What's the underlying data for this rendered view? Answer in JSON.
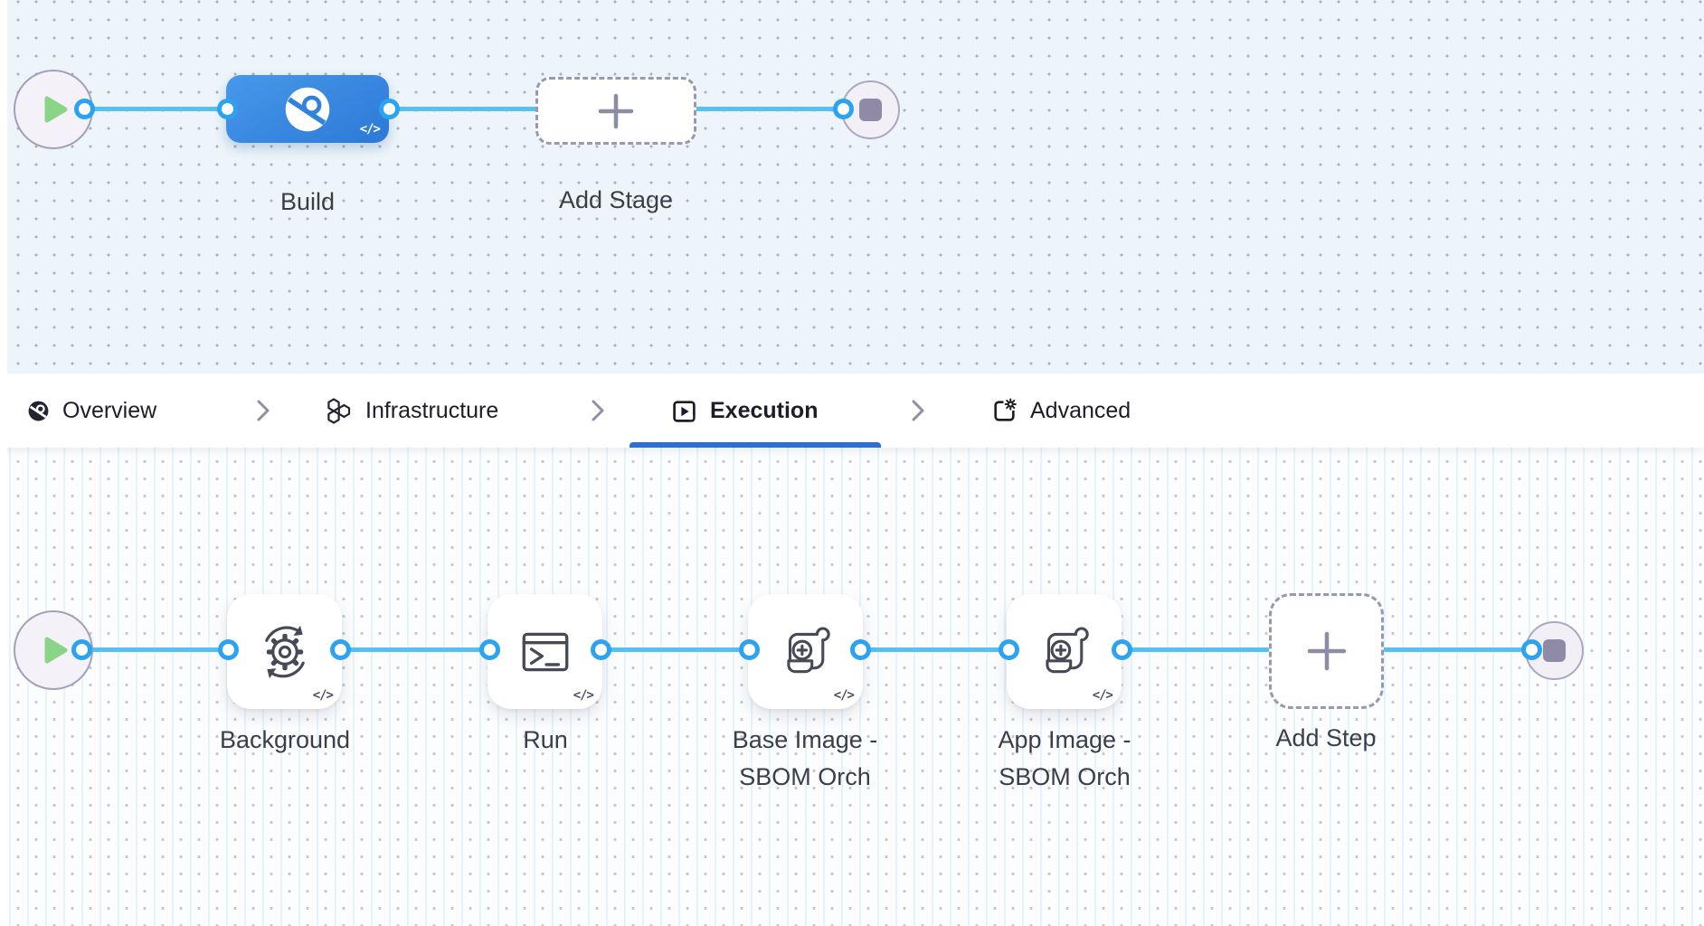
{
  "stage_pipeline": {
    "build_stage_label": "Build",
    "add_stage_label": "Add Stage",
    "code_badge": "</>"
  },
  "tab_bar": {
    "tabs": [
      {
        "label": "Overview",
        "icon": "ci-overview-icon",
        "active": false
      },
      {
        "label": "Infrastructure",
        "icon": "hexagons-icon",
        "active": false
      },
      {
        "label": "Execution",
        "icon": "play-square-icon",
        "active": true
      },
      {
        "label": "Advanced",
        "icon": "gear-square-icon",
        "active": false
      }
    ]
  },
  "execution_pipeline": {
    "steps": [
      {
        "label_line1": "Background",
        "label_line2": "",
        "icon": "gear-sync-icon"
      },
      {
        "label_line1": "Run",
        "label_line2": "",
        "icon": "terminal-icon"
      },
      {
        "label_line1": "Base Image -",
        "label_line2": "SBOM Orch",
        "icon": "scroll-plus-icon"
      },
      {
        "label_line1": "App Image -",
        "label_line2": "SBOM Orch",
        "icon": "scroll-plus-icon"
      }
    ],
    "add_step_label": "Add Step",
    "code_badge": "</>"
  },
  "colors": {
    "edge_blue": "#58bff2",
    "port_border_blue": "#2aa3f3",
    "stage_gradient_start": "#4798eb",
    "stage_gradient_end": "#2c79d6",
    "active_tab_underline": "#2b70d7",
    "start_play_green": "#8ad488",
    "end_square_gray": "#8f8ba6",
    "canvas_top_bg": "#eef5fa",
    "canvas_bottom_bg": "#fcfdff"
  }
}
